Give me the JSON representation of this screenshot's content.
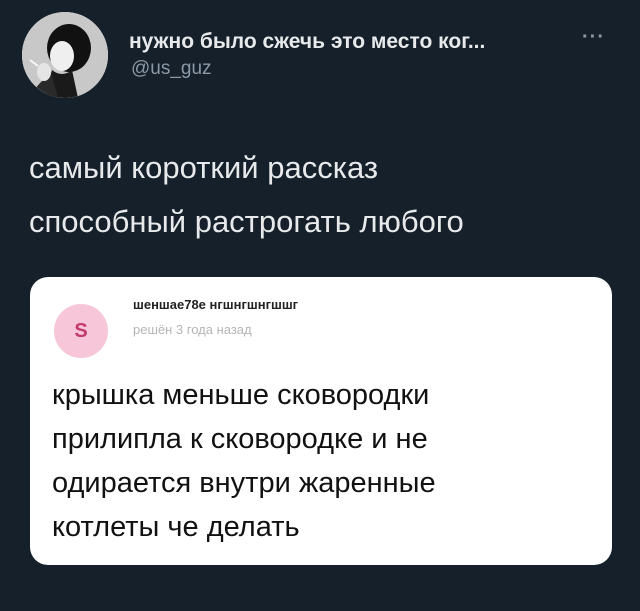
{
  "tweet": {
    "display_name": "нужно было сжечь это место ког...",
    "handle": "@us_guz",
    "more_icon": "more-icon",
    "text_lines": [
      "самый короткий рассказ",
      "способный растрогать любого"
    ]
  },
  "embedded_post": {
    "avatar_letter": "S",
    "username": "шеншае78е нгшнгшнгшшг",
    "timestamp": "решён 3 года назад",
    "text_lines": [
      "крышка меньше сковородки",
      "прилипла к сковородке и не",
      "одирается внутри жаренные",
      "котлеты че делать"
    ],
    "avatar_colors": {
      "background": "#f7c6d9",
      "letter": "#c43a6f"
    }
  },
  "colors": {
    "background": "#15202b",
    "primary_text": "#e7e9ea",
    "secondary_text": "#8b98a5",
    "card_background": "#ffffff"
  }
}
